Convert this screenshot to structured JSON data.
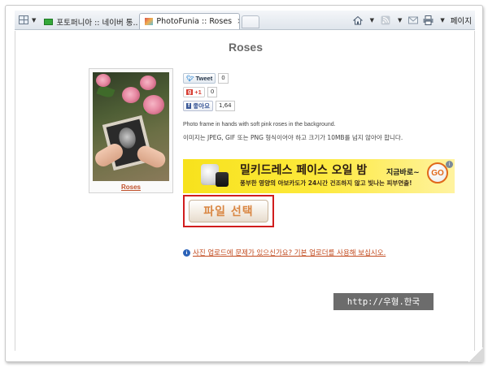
{
  "browser": {
    "tabs": [
      {
        "title": "포토퍼니아 :: 네이버 통...",
        "active": false
      },
      {
        "title": "PhotoFunia :: Roses",
        "active": true
      }
    ],
    "tab_close_glyph": "×",
    "page_menu_label": "페이지",
    "icons": [
      "grid-icon",
      "home-icon",
      "rss-icon",
      "mail-icon",
      "print-icon"
    ]
  },
  "page": {
    "title": "Roses",
    "thumbnail_caption": "Roses",
    "social": {
      "tweet_label": "Tweet",
      "tweet_count": "0",
      "gplus_label": "+1",
      "gplus_count": "0",
      "fb_label": "좋아요",
      "fb_count": "1,64"
    },
    "description_en": "Photo frame in hands with soft pink roses in the background.",
    "description_ko": "이미지는 JPEG, GIF 또는 PNG 형식이어야 하고 크기가 10MB를 넘지 않아야 합니다.",
    "ad": {
      "title": "밀키드레스 페이스 오일 밤",
      "subtitle": "풍부한 영양의 아보카도가 24시간 건조하지 않고 빛나는 피부연출!",
      "cta": "지금바로~",
      "go": "GO",
      "info": "i"
    },
    "select_file_button": "파일 선택",
    "help_link": "사진 업로드에 문제가 있으신가요? 기본 업로더를 사용해 보십시오.",
    "info_glyph": "i"
  },
  "watermark": "http://우형.한국",
  "colors": {
    "highlight_outline": "#d11d1d",
    "link": "#c24a1e",
    "ad_background": "#f7e21c"
  }
}
